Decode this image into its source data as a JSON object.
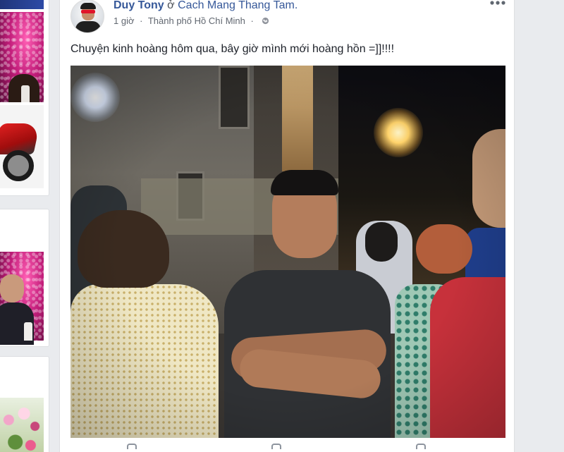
{
  "post": {
    "author": "Duy Tony",
    "at_word": "ở",
    "place": "Cach Mang Thang Tam.",
    "time": "1 giờ",
    "dot": "·",
    "location": "Thành phố Hồ Chí Minh",
    "dot2": "·",
    "privacy_icon": "globe-icon",
    "more_icon": "ellipsis-icon",
    "text": "Chuyện kinh hoàng hôm qua, bây giờ mình mới hoàng hồn =]]!!!!"
  },
  "colors": {
    "link": "#365899",
    "text": "#1d2129",
    "meta": "#616770",
    "background": "#e9ebee",
    "card": "#ffffff"
  }
}
